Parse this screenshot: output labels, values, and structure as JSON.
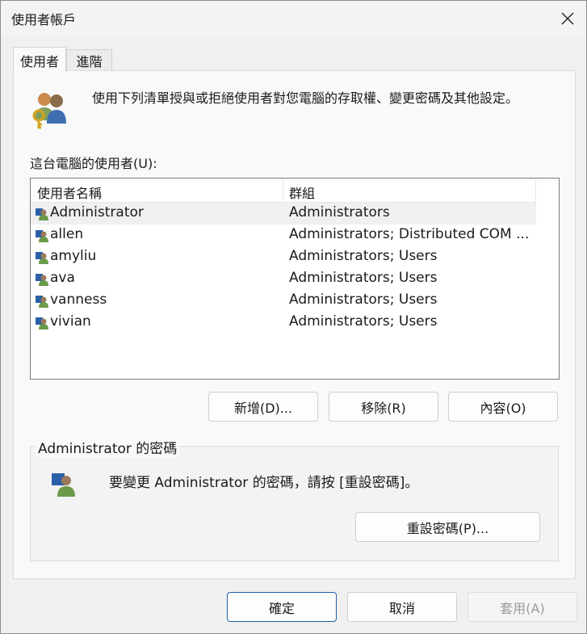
{
  "window": {
    "title": "使用者帳戶"
  },
  "tabs": [
    {
      "label": "使用者",
      "active": true
    },
    {
      "label": "進階",
      "active": false
    }
  ],
  "intro": {
    "text": "使用下列清單授與或拒絕使用者對您電腦的存取權、變更密碼及其他設定。"
  },
  "users": {
    "label": "這台電腦的使用者(U):",
    "columns": [
      "使用者名稱",
      "群組"
    ],
    "rows": [
      {
        "name": "Administrator",
        "groups": "Administrators",
        "selected": true
      },
      {
        "name": "allen",
        "groups": "Administrators; Distributed COM ...",
        "selected": false
      },
      {
        "name": "amyliu",
        "groups": "Administrators; Users",
        "selected": false
      },
      {
        "name": "ava",
        "groups": "Administrators; Users",
        "selected": false
      },
      {
        "name": "vanness",
        "groups": "Administrators; Users",
        "selected": false
      },
      {
        "name": "vivian",
        "groups": "Administrators; Users",
        "selected": false
      }
    ]
  },
  "list_buttons": {
    "add": "新增(D)...",
    "remove": "移除(R)",
    "properties": "內容(O)"
  },
  "password": {
    "group_title": "Administrator 的密碼",
    "text": "要變更 Administrator 的密碼，請按 [重設密碼]。",
    "reset_button": "重設密碼(P)..."
  },
  "footer": {
    "ok": "確定",
    "cancel": "取消",
    "apply": "套用(A)"
  },
  "colors": {
    "accent_border": "#1f5fa8",
    "selected_row": "#f0f0f0",
    "disabled_text": "#9a9a9a"
  }
}
